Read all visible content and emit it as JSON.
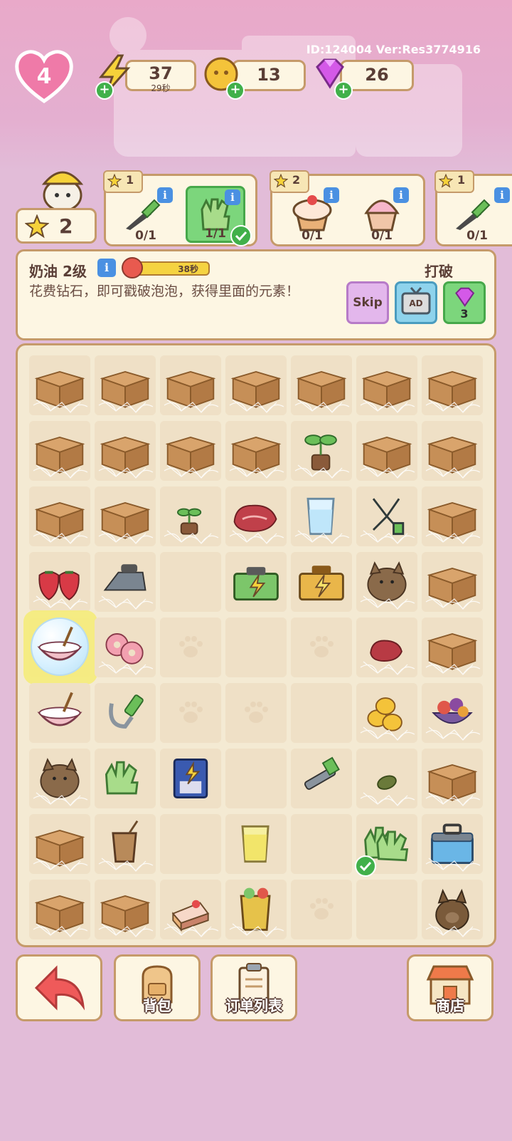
{
  "header": {
    "id_version": "ID:124004 Ver:Res3774916",
    "lives": "4",
    "energy": {
      "value": "37",
      "timer": "29秒"
    },
    "coins": {
      "value": "13"
    },
    "gems": {
      "value": "26"
    }
  },
  "player": {
    "stars": "2"
  },
  "orders": [
    {
      "reward_stars": "1",
      "items": [
        {
          "icon": "knife-icon",
          "count": "0/1",
          "done": false
        },
        {
          "icon": "glove-icon",
          "count": "1/1",
          "done": true
        }
      ]
    },
    {
      "reward_stars": "2",
      "items": [
        {
          "icon": "cupcake-icon",
          "count": "0/1",
          "done": false
        },
        {
          "icon": "cupcake-pink-icon",
          "count": "0/1",
          "done": false
        }
      ]
    },
    {
      "reward_stars": "1",
      "items": [
        {
          "icon": "knife-icon",
          "count": "0/1",
          "done": false
        }
      ]
    }
  ],
  "info_panel": {
    "title": "奶油 2级",
    "timer": "38秒",
    "description": "花费钻石，即可戳破泡泡，获得里面的元素！",
    "break_label": "打破",
    "skip_label": "Skip",
    "ad_label": "AD",
    "gem_cost": "3"
  },
  "board": {
    "rows": [
      [
        "box",
        "box",
        "box",
        "box",
        "box",
        "box",
        "box"
      ],
      [
        "box",
        "box",
        "box",
        "box",
        "sprout",
        "box",
        "box"
      ],
      [
        "box",
        "box",
        "sprout-small",
        "meat",
        "water-glass",
        "pliers",
        "box"
      ],
      [
        "strawberry",
        "iron",
        "empty",
        "toolbox-green",
        "toolbox-gold",
        "cat-pot",
        "box"
      ],
      [
        "bubble-bowl",
        "donut",
        "paw",
        "empty",
        "paw",
        "meat-small",
        "box"
      ],
      [
        "bowl",
        "hook",
        "paw",
        "paw",
        "empty",
        "coins",
        "fruit-bowl"
      ],
      [
        "cat-pot",
        "glove",
        "coffee-machine",
        "empty",
        "wrench",
        "leaf",
        "box"
      ],
      [
        "box",
        "iced-drink",
        "empty",
        "lemonade",
        "empty",
        "gloves-check",
        "cooler"
      ],
      [
        "box",
        "box",
        "cake",
        "fruit-drink",
        "paw",
        "empty",
        "cat-statue"
      ]
    ]
  },
  "colors": {
    "accent_pink": "#e9a9c9",
    "panel": "#fdf6e3",
    "border": "#c59a6a",
    "green": "#41b04a"
  },
  "bottom_bar": {
    "back_label": "",
    "backpack_label": "背包",
    "orders_label": "订单列表",
    "shop_label": "商店"
  }
}
